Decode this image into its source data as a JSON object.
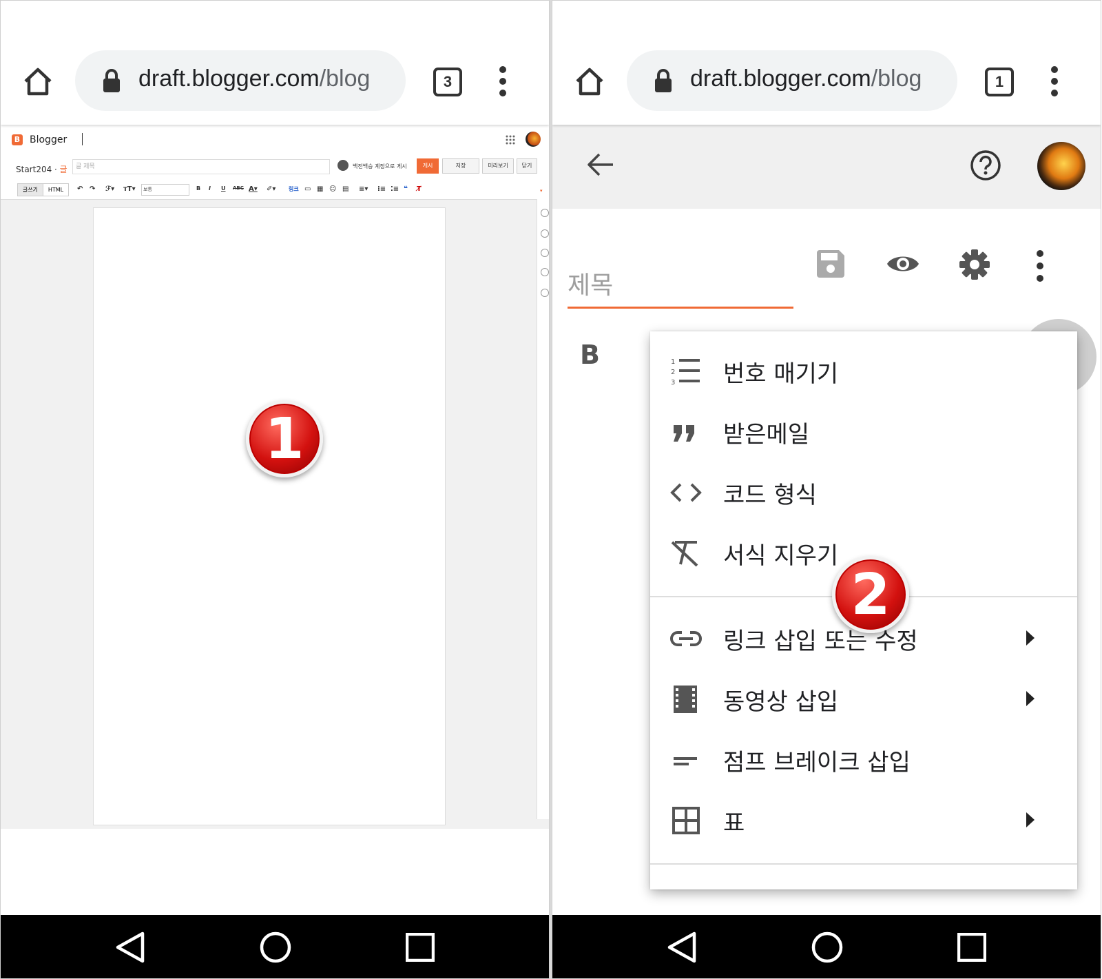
{
  "left": {
    "browser": {
      "url_domain": "draft.blogger.com",
      "url_path": "/blog",
      "tab_count": "3"
    },
    "blogger": {
      "app_name": "Blogger",
      "blog_name": "Start204 · ",
      "post_type": "글",
      "title_placeholder": "글 제목",
      "author_note": "백전백승 계정으로 게시",
      "buttons": {
        "publish": "게시",
        "save": "저장",
        "preview": "미리보기",
        "close": "닫기"
      },
      "modes": {
        "compose": "글쓰기",
        "html": "HTML"
      },
      "format_select": "보통"
    },
    "badge": "1"
  },
  "right": {
    "browser": {
      "url_domain": "draft.blogger.com",
      "url_path": "/blog",
      "tab_count": "1"
    },
    "editor": {
      "title_placeholder": "제목",
      "bold_label": "B"
    },
    "menu": {
      "items": [
        {
          "label": "번호 매기기",
          "icon": "numbered-list-icon"
        },
        {
          "label": "받은메일",
          "icon": "quote-icon"
        },
        {
          "label": "코드 형식",
          "icon": "code-icon"
        },
        {
          "label": "서식 지우기",
          "icon": "clear-format-icon"
        },
        {
          "label": "링크 삽입 또는 수정",
          "icon": "link-icon"
        },
        {
          "label": "동영상 삽입",
          "icon": "film-icon"
        },
        {
          "label": "점프 브레이크 삽입",
          "icon": "jump-break-icon"
        },
        {
          "label": "표",
          "icon": "table-icon"
        }
      ]
    },
    "badge": "2"
  },
  "colors": {
    "accent": "#f06a35",
    "badge": "#d3110f"
  }
}
